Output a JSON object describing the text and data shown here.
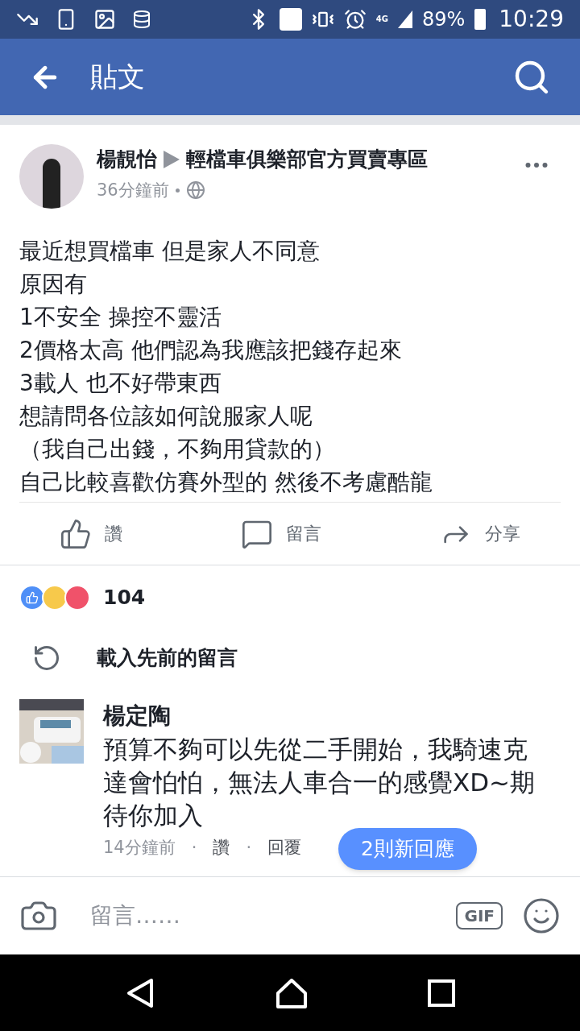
{
  "status_bar": {
    "network": "4G",
    "battery": "89%",
    "time": "10:29"
  },
  "header": {
    "title": "貼文"
  },
  "post": {
    "author": "楊靚怡",
    "group": "輕檔車俱樂部官方買賣專區",
    "time": "36分鐘前",
    "body": [
      "最近想買檔車 但是家人不同意",
      "原因有",
      "1不安全 操控不靈活",
      "2價格太高 他們認為我應該把錢存起來",
      "3載人 也不好帶東西",
      "想請問各位該如何說服家人呢",
      "（我自己出錢，不夠用貸款的）",
      "自己比較喜歡仿賽外型的 然後不考慮酷龍"
    ],
    "actions": [
      {
        "kind": "like",
        "label": "讚"
      },
      {
        "kind": "comment",
        "label": "留言"
      },
      {
        "kind": "share",
        "label": "分享"
      }
    ]
  },
  "reactions": {
    "count": "104"
  },
  "load_previous": "載入先前的留言",
  "comments": [
    {
      "author": "楊定陶",
      "text": "預算不夠可以先從二手開始，我騎速克達會怕怕，無法人車合一的感覺XD~期待你加入",
      "time": "14分鐘前",
      "separator": "·",
      "like": "讚",
      "reply": "回覆"
    }
  ],
  "new_replies": "2則新回應",
  "composer": {
    "placeholder": "留言……",
    "gif": "GIF"
  }
}
